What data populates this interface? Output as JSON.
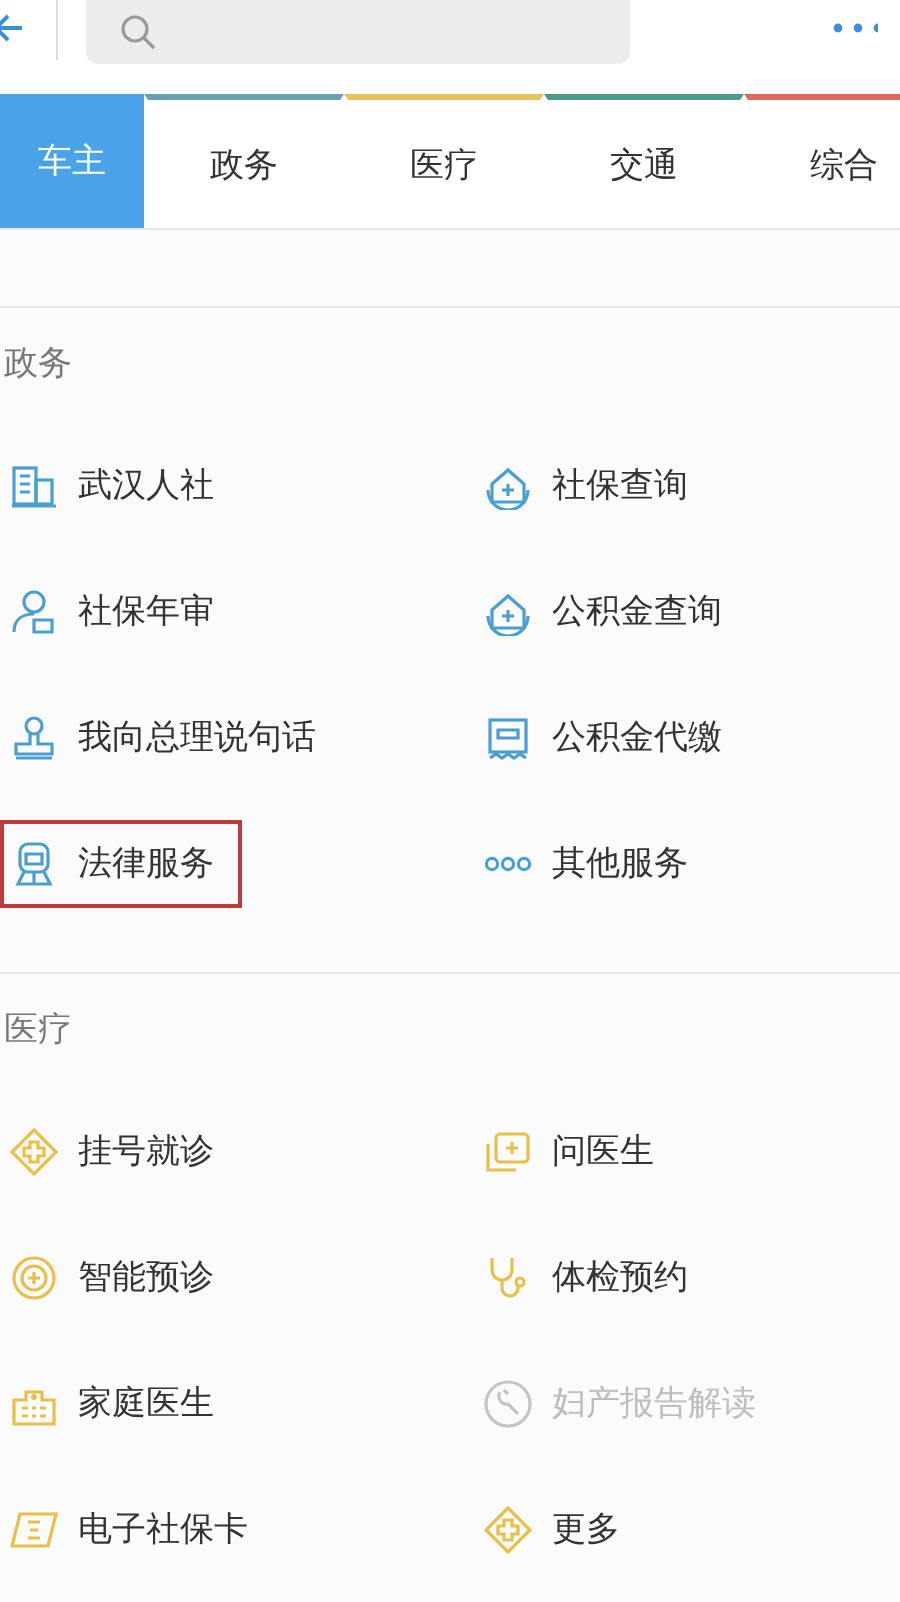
{
  "tabs": [
    {
      "label": "车主",
      "selected": true,
      "color": "#4aa3e8"
    },
    {
      "label": "政务",
      "selected": false,
      "color": "#6a9fb8"
    },
    {
      "label": "医疗",
      "selected": false,
      "color": "#e6c35c"
    },
    {
      "label": "交通",
      "selected": false,
      "color": "#4b9a8c"
    },
    {
      "label": "综合",
      "selected": false,
      "color": "#e06a5a"
    }
  ],
  "sections": [
    {
      "title": "政务",
      "color": "#4a9fd0",
      "items": [
        {
          "label": "武汉人社",
          "disabled": false,
          "highlighted": false
        },
        {
          "label": "社保查询",
          "disabled": false,
          "highlighted": false
        },
        {
          "label": "社保年审",
          "disabled": false,
          "highlighted": false
        },
        {
          "label": "公积金查询",
          "disabled": false,
          "highlighted": false
        },
        {
          "label": "我向总理说句话",
          "disabled": false,
          "highlighted": false
        },
        {
          "label": "公积金代缴",
          "disabled": false,
          "highlighted": false
        },
        {
          "label": "法律服务",
          "disabled": false,
          "highlighted": true
        },
        {
          "label": "其他服务",
          "disabled": false,
          "highlighted": false
        }
      ]
    },
    {
      "title": "医疗",
      "color": "#e8bf4a",
      "items": [
        {
          "label": "挂号就诊",
          "disabled": false,
          "highlighted": false
        },
        {
          "label": "问医生",
          "disabled": false,
          "highlighted": false
        },
        {
          "label": "智能预诊",
          "disabled": false,
          "highlighted": false
        },
        {
          "label": "体检预约",
          "disabled": false,
          "highlighted": false
        },
        {
          "label": "家庭医生",
          "disabled": false,
          "highlighted": false
        },
        {
          "label": "妇产报告解读",
          "disabled": true,
          "highlighted": false
        },
        {
          "label": "电子社保卡",
          "disabled": false,
          "highlighted": false
        },
        {
          "label": "更多",
          "disabled": false,
          "highlighted": false
        }
      ]
    }
  ]
}
